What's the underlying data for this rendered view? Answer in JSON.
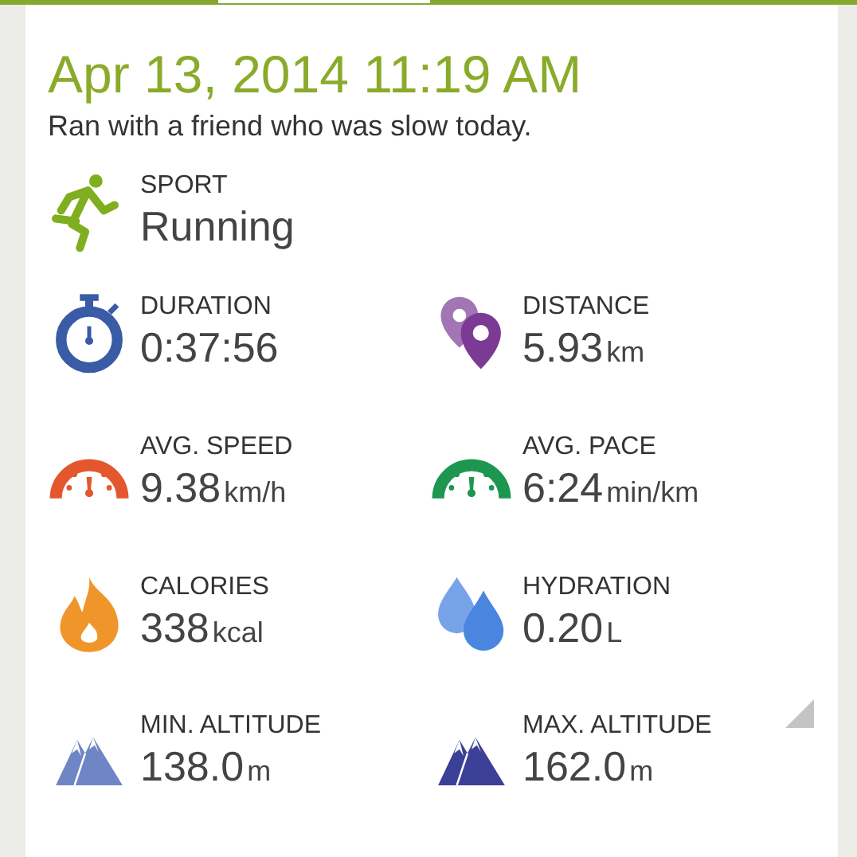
{
  "header": {
    "title": "Apr 13, 2014 11:19 AM",
    "note": "Ran with a friend who was slow today."
  },
  "sport": {
    "label": "SPORT",
    "value": "Running",
    "kind": "runner",
    "color": "#7fae1f"
  },
  "stats": [
    {
      "label": "DURATION",
      "value": "0:37:56",
      "kind": "stopwatch",
      "color": "#3a5ba5"
    },
    {
      "label": "DISTANCE",
      "value": "5.93",
      "unit": "km",
      "kind": "pins",
      "color": "#7b3a94"
    },
    {
      "label": "AVG. SPEED",
      "value": "9.38",
      "unit": "km/h",
      "kind": "gauge",
      "color": "#e4572e"
    },
    {
      "label": "AVG. PACE",
      "value": "6:24",
      "unit": "min/km",
      "kind": "gauge",
      "color": "#1d9650"
    },
    {
      "label": "CALORIES",
      "value": "338",
      "unit": "kcal",
      "kind": "flame",
      "color": "#f0952a"
    },
    {
      "label": "HYDRATION",
      "value": "0.20",
      "unit": "L",
      "kind": "drops",
      "color": "#4a86e0"
    },
    {
      "label": "MIN. ALTITUDE",
      "value": "138.0",
      "unit": "m",
      "kind": "mountains",
      "color": "#6f86c6"
    },
    {
      "label": "MAX. ALTITUDE",
      "value": "162.0",
      "unit": "m",
      "kind": "mountains",
      "color": "#3b3f96"
    }
  ]
}
